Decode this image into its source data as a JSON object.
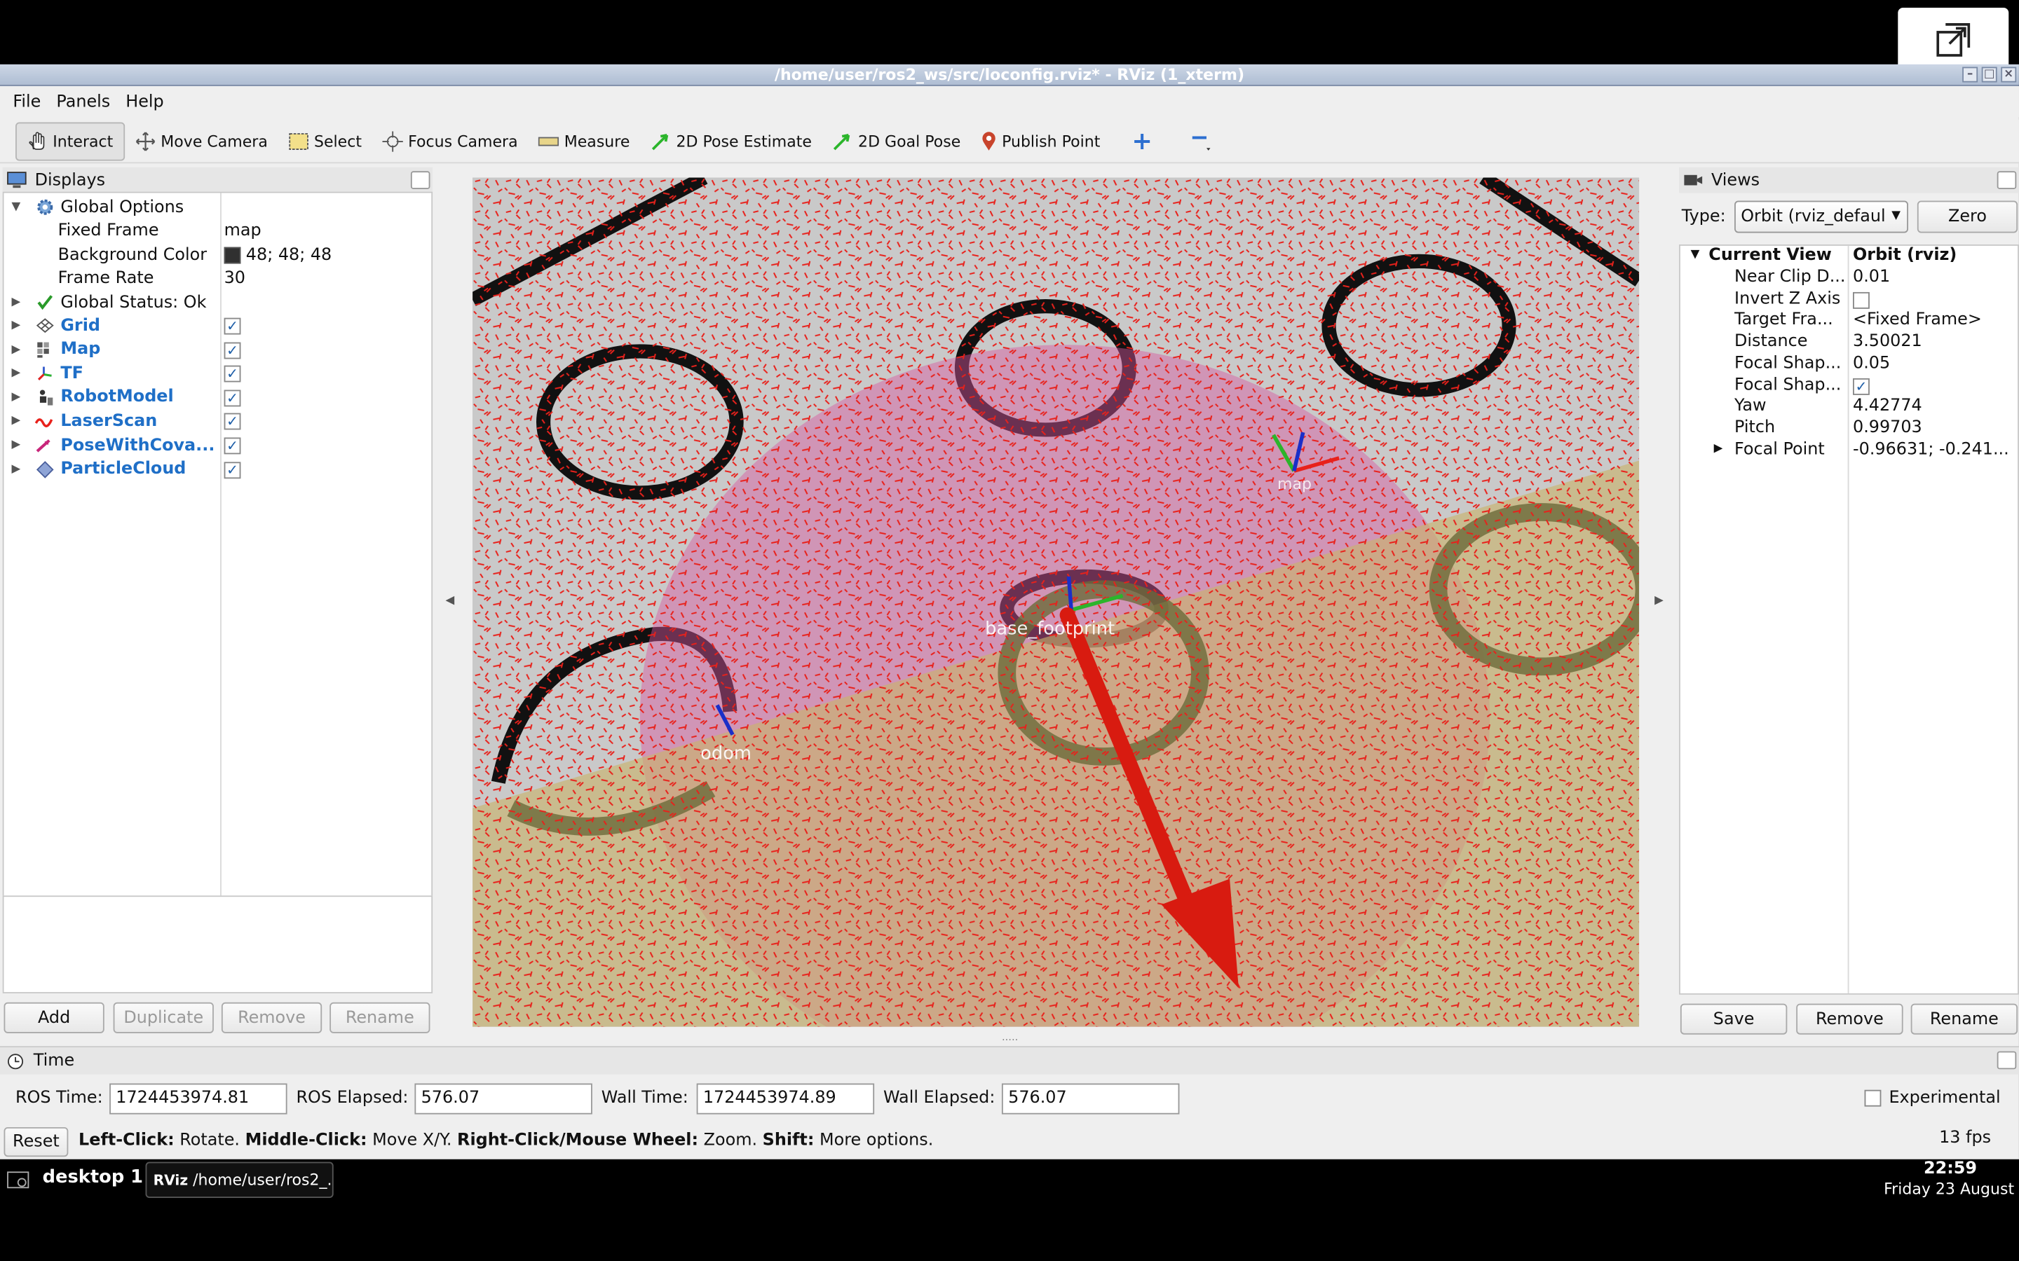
{
  "window": {
    "title": "/home/user/ros2_ws/src/loconfig.rviz* - RViz (1_xterm)"
  },
  "menu": [
    "File",
    "Panels",
    "Help"
  ],
  "toolbar": {
    "interact": "Interact",
    "move_camera": "Move Camera",
    "select": "Select",
    "focus_camera": "Focus Camera",
    "measure": "Measure",
    "pose_estimate": "2D Pose Estimate",
    "goal_pose": "2D Goal Pose",
    "publish_point": "Publish Point"
  },
  "displays": {
    "title": "Displays",
    "global_options": "Global Options",
    "fixed_frame_label": "Fixed Frame",
    "fixed_frame_value": "map",
    "background_color_label": "Background Color",
    "background_color_value": "48; 48; 48",
    "background_color_swatch": "#303030",
    "frame_rate_label": "Frame Rate",
    "frame_rate_value": "30",
    "global_status": "Global Status: Ok",
    "items": [
      {
        "label": "Grid",
        "checked": true
      },
      {
        "label": "Map",
        "checked": true
      },
      {
        "label": "TF",
        "checked": true
      },
      {
        "label": "RobotModel",
        "checked": true
      },
      {
        "label": "LaserScan",
        "checked": true
      },
      {
        "label": "PoseWithCova...",
        "checked": true
      },
      {
        "label": "ParticleCloud",
        "checked": true
      }
    ],
    "buttons": {
      "add": "Add",
      "duplicate": "Duplicate",
      "remove": "Remove",
      "rename": "Rename"
    }
  },
  "viewport": {
    "frame_labels": [
      "base_footprint",
      "odom",
      "map"
    ],
    "colors": {
      "particles": "#e8211b",
      "costmap_pink": "#d957a0",
      "costmap_yellow": "#c9b36a",
      "walls": "#111111",
      "floor": "#c8c8c8",
      "arrow": "#d81b10"
    }
  },
  "views": {
    "title": "Views",
    "type_label": "Type:",
    "type_value": "Orbit (rviz_defaul",
    "zero": "Zero",
    "current_view": "Current View",
    "current_view_value": "Orbit (rviz)",
    "props": [
      {
        "k": "Near Clip D...",
        "v": "0.01"
      },
      {
        "k": "Invert Z Axis",
        "v": ""
      },
      {
        "k": "Target Fra...",
        "v": "<Fixed Frame>"
      },
      {
        "k": "Distance",
        "v": "3.50021"
      },
      {
        "k": "Focal Shap...",
        "v": "0.05"
      },
      {
        "k": "Focal Shap...",
        "v": ""
      },
      {
        "k": "Yaw",
        "v": "4.42774"
      },
      {
        "k": "Pitch",
        "v": "0.99703"
      },
      {
        "k": "Focal Point",
        "v": "-0.96631; -0.241..."
      }
    ],
    "buttons": {
      "save": "Save",
      "remove": "Remove",
      "rename": "Rename"
    }
  },
  "time": {
    "title": "Time",
    "ros_time_label": "ROS Time:",
    "ros_time": "1724453974.81",
    "ros_elapsed_label": "ROS Elapsed:",
    "ros_elapsed": "576.07",
    "wall_time_label": "Wall Time:",
    "wall_time": "1724453974.89",
    "wall_elapsed_label": "Wall Elapsed:",
    "wall_elapsed": "576.07",
    "experimental": "Experimental"
  },
  "status": {
    "reset": "Reset",
    "b1": "Left-Click:",
    "t1": " Rotate. ",
    "b2": "Middle-Click:",
    "t2": " Move X/Y. ",
    "b3": "Right-Click/Mouse Wheel:",
    "t3": " Zoom. ",
    "b4": "Shift:",
    "t4": " More options.",
    "fps": "13 fps"
  },
  "taskbar": {
    "desktop": "desktop 1",
    "task": "/home/user/ros2_...",
    "clock": "22:59",
    "date": "Friday 23 August"
  }
}
